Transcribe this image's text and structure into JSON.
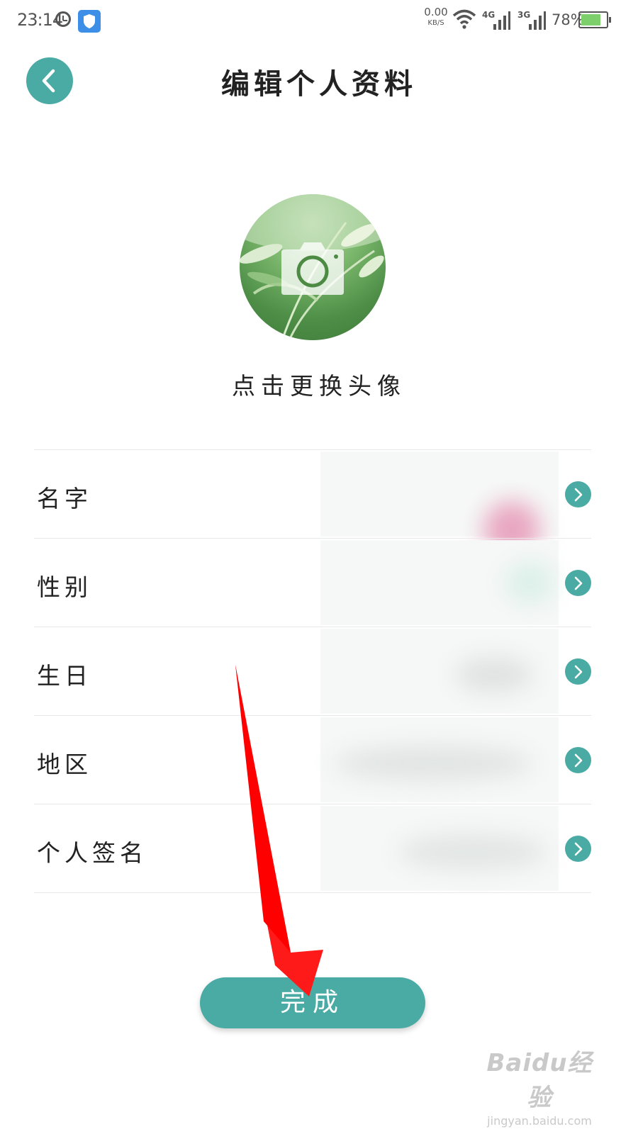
{
  "status_bar": {
    "time": "23:14",
    "net_speed_value": "0.00",
    "net_speed_unit": "KB/S",
    "signal_1": "4G",
    "signal_2": "3G",
    "battery_percent": "78%",
    "battery_level": 0.78,
    "icons": [
      "alarm-icon",
      "shield-icon",
      "wifi-icon",
      "signal-icon",
      "battery-icon"
    ]
  },
  "header": {
    "title": "编辑个人资料",
    "back_icon": "chevron-left-icon"
  },
  "avatar": {
    "hint": "点击更换头像",
    "overlay_icon": "camera-icon"
  },
  "profile_fields": [
    {
      "label": "名字"
    },
    {
      "label": "性别"
    },
    {
      "label": "生日"
    },
    {
      "label": "地区"
    },
    {
      "label": "个人签名"
    }
  ],
  "done_button": {
    "label": "完成"
  },
  "watermark": {
    "logo": "Baidu经验",
    "url": "jingyan.baidu.com"
  },
  "colors": {
    "accent": "#4aaba5",
    "annotation_arrow": "#ff0000",
    "battery": "#7ccf6a"
  }
}
